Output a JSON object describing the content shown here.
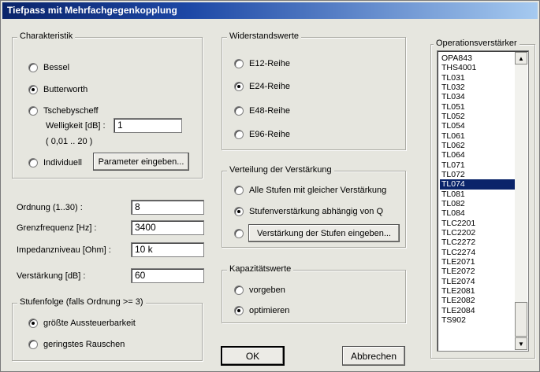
{
  "window": {
    "title": "Tiefpass mit Mehrfachgegenkopplung"
  },
  "charakteristik": {
    "legend": "Charakteristik",
    "bessel": "Bessel",
    "butterworth": "Butterworth",
    "tschebyscheff": "Tschebyscheff",
    "welligkeit_label": "Welligkeit [dB] :",
    "welligkeit_value": "1",
    "welligkeit_range": "( 0,01 .. 20 )",
    "individuell": "Individuell",
    "parameter_button": "Parameter eingeben...",
    "selected": "Butterworth"
  },
  "params": {
    "ordnung_label": "Ordnung (1..30) :",
    "ordnung_value": "8",
    "grenzfrequenz_label": "Grenzfrequenz [Hz] :",
    "grenzfrequenz_value": "3400",
    "impedanz_label": "Impedanzniveau [Ohm] :",
    "impedanz_value": "10 k",
    "verstaerkung_label": "Verstärkung [dB] :",
    "verstaerkung_value": "60"
  },
  "stufenfolge": {
    "legend": "Stufenfolge (falls Ordnung >= 3)",
    "option1": "größte Aussteuerbarkeit",
    "option2": "geringstes Rauschen",
    "selected": "größte Aussteuerbarkeit"
  },
  "widerstand": {
    "legend": "Widerstandswerte",
    "e12": "E12-Reihe",
    "e24": "E24-Reihe",
    "e48": "E48-Reihe",
    "e96": "E96-Reihe",
    "selected": "E24-Reihe"
  },
  "verteilung": {
    "legend": "Verteilung der Verstärkung",
    "option1": "Alle Stufen mit gleicher Verstärkung",
    "option2": "Stufenverstärkung abhängig von Q",
    "stufen_button": "Verstärkung der Stufen eingeben...",
    "selected": "Stufenverstärkung abhängig von Q"
  },
  "kapazitaet": {
    "legend": "Kapazitätswerte",
    "option1": "vorgeben",
    "option2": "optimieren",
    "selected": "optimieren"
  },
  "buttons": {
    "ok": "OK",
    "abbrechen": "Abbrechen"
  },
  "opamp": {
    "legend": "Operationsverstärker",
    "items": [
      "OPA843",
      "THS4001",
      "TL031",
      "TL032",
      "TL034",
      "TL051",
      "TL052",
      "TL054",
      "TL061",
      "TL062",
      "TL064",
      "TL071",
      "TL072",
      "TL074",
      "TL081",
      "TL082",
      "TL084",
      "TLC2201",
      "TLC2202",
      "TLC2272",
      "TLC2274",
      "TLE2071",
      "TLE2072",
      "TLE2074",
      "TLE2081",
      "TLE2082",
      "TLE2084",
      "TS902"
    ],
    "selected": "TL074"
  },
  "scroll": {
    "up_icon": "triangle-up-icon",
    "down_icon": "triangle-down-icon"
  }
}
